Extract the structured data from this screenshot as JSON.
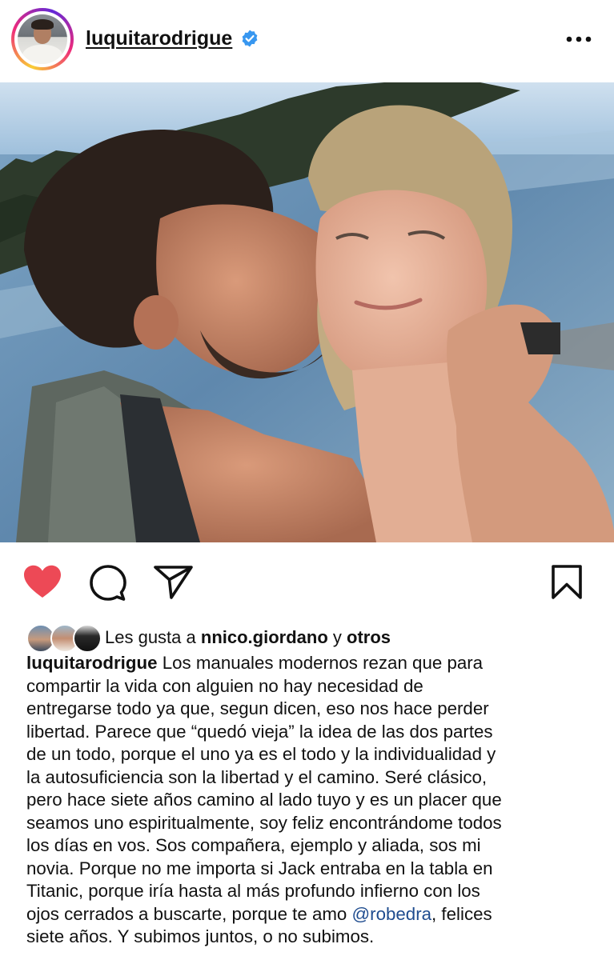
{
  "post": {
    "username": "luquitarodrigue",
    "verified": true,
    "more_icon": "ellipsis-icon"
  },
  "actions": {
    "like_icon": "heart-filled-icon",
    "like_color": "#ed4956",
    "comment_icon": "comment-bubble-icon",
    "share_icon": "paper-plane-icon",
    "save_icon": "bookmark-icon"
  },
  "likes": {
    "prefix": "Les gusta a",
    "user": "nnico.giordano",
    "joiner": "y",
    "others": "otros"
  },
  "caption": {
    "username": "luquitarodrigue",
    "lines": [
      "Los manuales modernos rezan que para",
      "compartir la vida con alguien no hay necesidad de",
      "entregarse todo ya que, segun dicen, eso nos hace perder",
      "libertad. Parece que “quedó vieja” la idea de las dos partes",
      "de un todo, porque el uno ya es el todo y la individualidad y",
      "la autosuficiencia son la libertad y el camino. Seré clásico,",
      "pero hace siete años camino al lado tuyo y es un placer que",
      "seamos uno espiritualmente, soy feliz encontrándome todos",
      "los días en vos. Sos compañera, ejemplo y aliada, sos mi",
      "novia. Porque no me importa si Jack entraba en la tabla en",
      "Titanic, porque iría hasta al más profundo infierno con los",
      "ojos cerrados a buscarte, porque te amo"
    ],
    "mention": "@robedra",
    "after_mention": ", felices",
    "last_line": "siete años. Y subimos juntos, o no subimos."
  },
  "colors": {
    "mention": "#1f4c8f",
    "verified_badge": "#3897f0"
  }
}
